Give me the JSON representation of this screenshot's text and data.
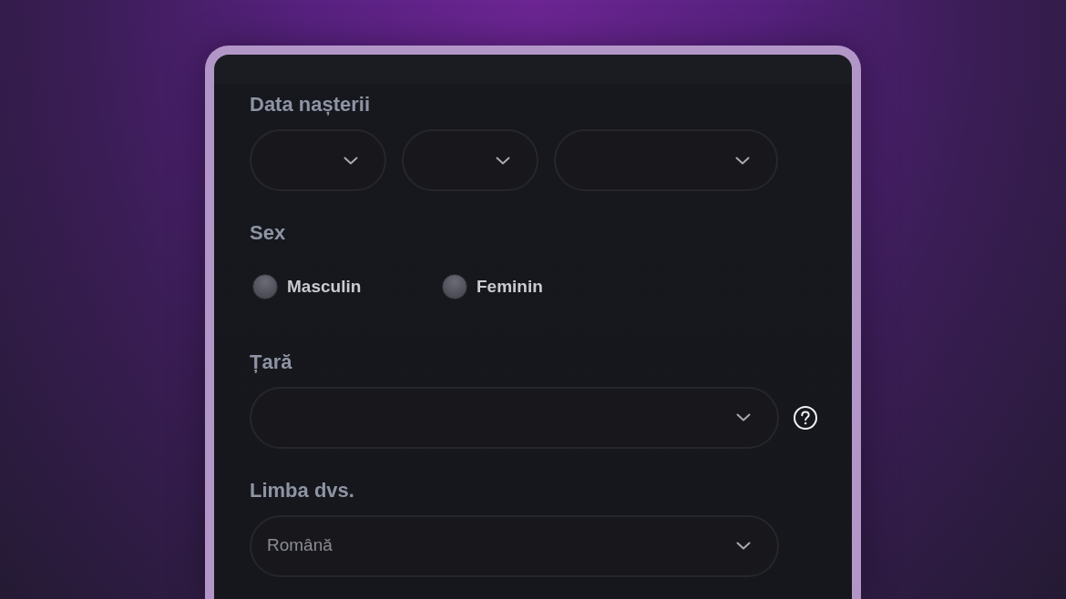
{
  "fields": [
    {
      "kind": "date",
      "label": "Data nașterii"
    },
    {
      "kind": "radio",
      "label": "Sex",
      "options": [
        {
          "label": "Masculin",
          "selected": false
        },
        {
          "label": "Feminin",
          "selected": false
        }
      ]
    },
    {
      "kind": "select",
      "label": "Țară",
      "help": true
    },
    {
      "kind": "select",
      "label": "Limba dvs.",
      "value": "Română"
    }
  ]
}
